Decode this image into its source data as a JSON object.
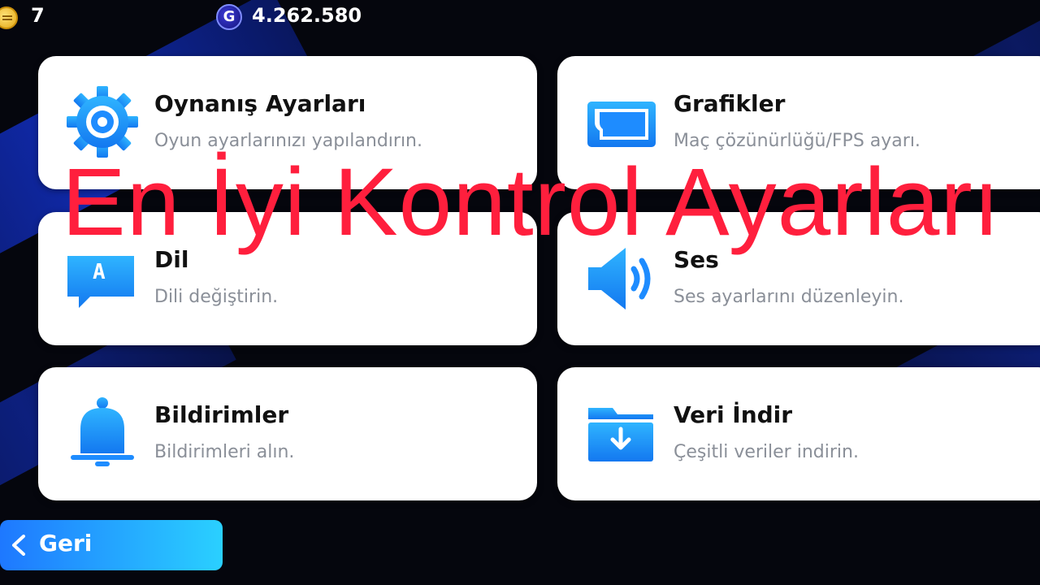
{
  "topbar": {
    "coins": "7",
    "gp_badge": "G",
    "gp": "4.262.580"
  },
  "cards": [
    {
      "title": "Oynanış Ayarları",
      "desc": "Oyun ayarlarınızı yapılandırın.",
      "icon": "gear-icon"
    },
    {
      "title": "Grafikler",
      "desc": "Maç çözünürlüğü/FPS ayarı.",
      "icon": "screen-icon"
    },
    {
      "title": "Dil",
      "desc": "Dili değiştirin.",
      "icon": "language-bubble-icon"
    },
    {
      "title": "Ses",
      "desc": "Ses ayarlarını düzenleyin.",
      "icon": "speaker-icon"
    },
    {
      "title": "Bildirimler",
      "desc": "Bildirimleri alın.",
      "icon": "bell-icon"
    },
    {
      "title": "Veri İndir",
      "desc": "Çeşitli veriler indirin.",
      "icon": "download-folder-icon"
    }
  ],
  "language_glyph": "A",
  "back_label": "Geri",
  "overlay_title": "En İyi Kontrol Ayarları",
  "colors": {
    "accent": "#1e90ff",
    "overlay": "#ff1f3d",
    "card_bg": "#ffffff"
  }
}
